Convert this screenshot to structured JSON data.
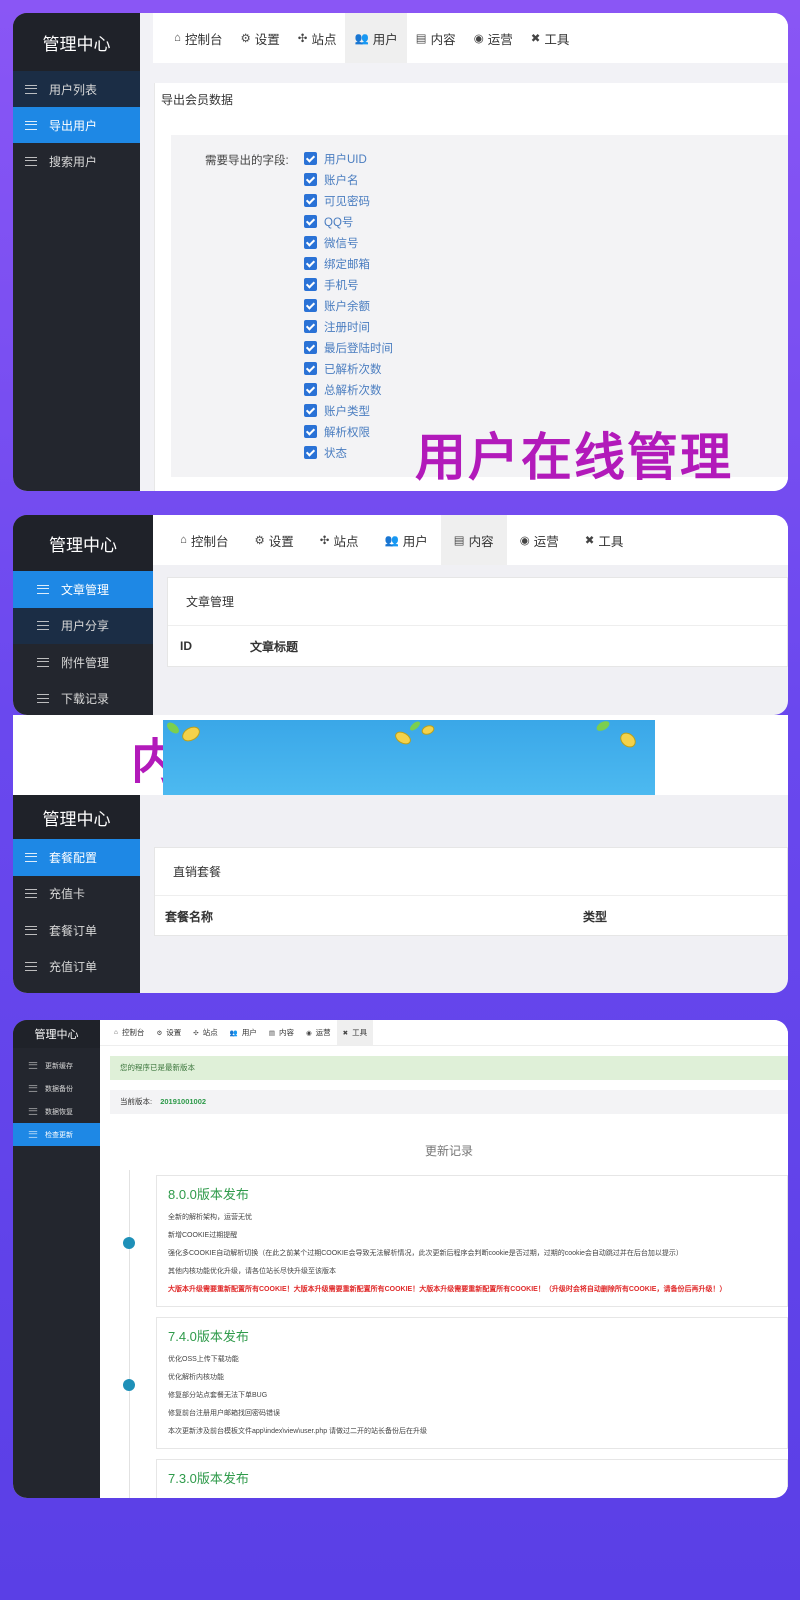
{
  "brand": "管理中心",
  "nav_tabs": [
    {
      "icon": "home-icon",
      "glyph": "⌂",
      "label": "控制台"
    },
    {
      "icon": "gear-icon",
      "glyph": "⚙",
      "label": "设置"
    },
    {
      "icon": "grid-icon",
      "glyph": "✣",
      "label": "站点"
    },
    {
      "icon": "users-icon",
      "glyph": "👥",
      "label": "用户"
    },
    {
      "icon": "file-icon",
      "glyph": "▤",
      "label": "内容"
    },
    {
      "icon": "globe-icon",
      "glyph": "◉",
      "label": "运营"
    },
    {
      "icon": "wrench-icon",
      "glyph": "✖",
      "label": "工具"
    }
  ],
  "panel1": {
    "active_tab": "用户",
    "sidebar": [
      "用户列表",
      "导出用户",
      "搜索用户"
    ],
    "card_title": "导出会员数据",
    "fields_label": "需要导出的字段:",
    "fields": [
      "用户UID",
      "账户名",
      "可见密码",
      "QQ号",
      "微信号",
      "绑定邮箱",
      "手机号",
      "账户余额",
      "注册时间",
      "最后登陆时间",
      "已解析次数",
      "总解析次数",
      "账户类型",
      "解析权限",
      "状态"
    ],
    "watermark": "用户在线管理"
  },
  "panel2": {
    "active_tab": "内容",
    "sidebar": [
      "文章管理",
      "用户分享",
      "附件管理",
      "下载记录"
    ],
    "card_title": "文章管理",
    "columns": [
      "ID",
      "文章标题"
    ],
    "watermark_partial": "内"
  },
  "panel3": {
    "sidebar": [
      "套餐配置",
      "充值卡",
      "套餐订单",
      "充值订单"
    ],
    "card_title": "直销套餐",
    "columns": [
      "套餐名称",
      "类型"
    ]
  },
  "panel4": {
    "active_tab": "工具",
    "sidebar": [
      "更新缓存",
      "数据备份",
      "数据恢复",
      "检查更新"
    ],
    "alert": "您的程序已是最新版本",
    "version_label": "当前版本:",
    "version_value": "20191001002",
    "changelog_title": "更新记录",
    "releases": [
      {
        "title": "8.0.0版本发布",
        "lines": [
          {
            "text": "全新的解析架构，运营无忧",
            "red": false
          },
          {
            "text": "新增COOKIE过期提醒",
            "red": false
          },
          {
            "text": "强化多COOKIE自动解析切换（在此之前某个过期COOKIE会导致无法解析情况，此次更新后程序会判断cookie是否过期，过期的cookie会自动跳过并在后台加以提示）",
            "red": false
          },
          {
            "text": "其他内核功能优化升级，请各位站长尽快升级至该版本",
            "red": false
          },
          {
            "text": "大版本升级需要重新配置所有COOKIE！大版本升级需要重新配置所有COOKIE！大版本升级需要重新配置所有COOKIE！（升级时会将自动删除所有COOKIE，请备份后再升级！）",
            "red": true
          }
        ]
      },
      {
        "title": "7.4.0版本发布",
        "lines": [
          {
            "text": "优化OSS上传下载功能",
            "red": false
          },
          {
            "text": "优化解析内核功能",
            "red": false
          },
          {
            "text": "修复部分站点套餐无法下单BUG",
            "red": false
          },
          {
            "text": "修复前台注册用户邮箱找回密码错误",
            "red": false
          },
          {
            "text": "本次更新涉及前台模板文件app\\index\\view\\user.php 请做过二开的站长备份后在升级",
            "red": false
          }
        ]
      },
      {
        "title": "7.3.0版本发布",
        "lines": []
      }
    ]
  },
  "colors": {
    "accent": "#1e88e5",
    "sidebar": "#23262e",
    "watermark": "#b21aba",
    "release_title": "#2e9a4a",
    "alert_bg": "#dff0d8"
  }
}
